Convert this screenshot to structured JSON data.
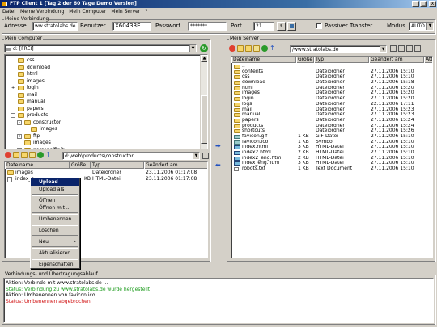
{
  "window": {
    "title": "FTP Client 1 [Tag 2 der 60 Tage Demo Version]",
    "min": "_",
    "max": "□",
    "close": "x"
  },
  "menu": [
    "Datei",
    "Meine Verbindung",
    "Mein Computer",
    "Mein Server",
    "?"
  ],
  "connection": {
    "group_label": "Meine Verbindung",
    "address_label": "Adresse",
    "address": "ww.stratolabs.de",
    "user_label": "Benutzer",
    "user": "X60433E",
    "password_label": "Passwort",
    "password": "*******",
    "port_label": "Port",
    "port": "21",
    "passive_label": "Passiver Transfer",
    "mode_label": "Modus",
    "mode": "AUTO"
  },
  "local": {
    "group_label": "Mein Computer",
    "drive": "d: [FREI]",
    "tree": [
      {
        "label": "css",
        "indent": 2,
        "expander": ""
      },
      {
        "label": "download",
        "indent": 2,
        "expander": ""
      },
      {
        "label": "html",
        "indent": 2,
        "expander": ""
      },
      {
        "label": "images",
        "indent": 2,
        "expander": ""
      },
      {
        "label": "login",
        "indent": 2,
        "expander": "+"
      },
      {
        "label": "mail",
        "indent": 2,
        "expander": ""
      },
      {
        "label": "manual",
        "indent": 2,
        "expander": ""
      },
      {
        "label": "papers",
        "indent": 2,
        "expander": ""
      },
      {
        "label": "products",
        "indent": 2,
        "expander": "-"
      },
      {
        "label": "constructor",
        "indent": 3,
        "expander": "-"
      },
      {
        "label": "images",
        "indent": 4,
        "expander": ""
      },
      {
        "label": "ftp",
        "indent": 3,
        "expander": "+"
      },
      {
        "label": "images",
        "indent": 3,
        "expander": ""
      },
      {
        "label": "personalfinity",
        "indent": 3,
        "expander": "+"
      }
    ],
    "path": "d:\\web\\products\\constructor",
    "columns": [
      "Dateiname",
      "Größe",
      "Typ",
      "Geändert am"
    ],
    "files": [
      {
        "name": "images",
        "size": "",
        "type": "Dateiordner",
        "date": "23.11.2006 01:17:08",
        "kind": "folder"
      },
      {
        "name": "index_c",
        "size": "KB",
        "type": "HTML-Datei",
        "date": "23.11.2006 01:17:08",
        "kind": "file"
      }
    ]
  },
  "context_menu": [
    {
      "label": "Upload",
      "selected": true
    },
    {
      "label": "Upload als"
    },
    {
      "sep": true
    },
    {
      "label": "Öffnen"
    },
    {
      "label": "Öffnen mit ..."
    },
    {
      "sep": true
    },
    {
      "label": "Umbenennen"
    },
    {
      "sep": true
    },
    {
      "label": "Löschen"
    },
    {
      "sep": true
    },
    {
      "label": "Neu",
      "arrow": "►"
    },
    {
      "sep": true
    },
    {
      "label": "Aktualisieren"
    },
    {
      "sep": true
    },
    {
      "label": "Eigenschaften"
    }
  ],
  "remote": {
    "group_label": "Mein Server",
    "path": "/www.stratolabs.de",
    "columns": [
      "Dateiname",
      "Größe",
      "Typ",
      "Geändert am",
      "Attri"
    ],
    "files": [
      {
        "name": "..",
        "size": "",
        "type": "",
        "date": "",
        "kind": "folder"
      },
      {
        "name": "contents",
        "size": "",
        "type": "Dateiordner",
        "date": "27.11.2006 15:10",
        "kind": "folder"
      },
      {
        "name": "css",
        "size": "",
        "type": "Dateiordner",
        "date": "27.11.2006 15:10",
        "kind": "folder"
      },
      {
        "name": "download",
        "size": "",
        "type": "Dateiordner",
        "date": "27.11.2006 15:18",
        "kind": "folder"
      },
      {
        "name": "html",
        "size": "",
        "type": "Dateiordner",
        "date": "27.11.2006 15:20",
        "kind": "folder"
      },
      {
        "name": "images",
        "size": "",
        "type": "Dateiordner",
        "date": "27.11.2006 15:20",
        "kind": "folder"
      },
      {
        "name": "login",
        "size": "",
        "type": "Dateiordner",
        "date": "27.11.2006 15:20",
        "kind": "folder"
      },
      {
        "name": "logs",
        "size": "",
        "type": "Dateiordner",
        "date": "22.11.2006 17:11",
        "kind": "folder"
      },
      {
        "name": "mail",
        "size": "",
        "type": "Dateiordner",
        "date": "27.11.2006 15:23",
        "kind": "folder"
      },
      {
        "name": "manual",
        "size": "",
        "type": "Dateiordner",
        "date": "27.11.2006 15:23",
        "kind": "folder"
      },
      {
        "name": "papers",
        "size": "",
        "type": "Dateiordner",
        "date": "27.11.2006 15:24",
        "kind": "folder"
      },
      {
        "name": "products",
        "size": "",
        "type": "Dateiordner",
        "date": "27.11.2006 15:24",
        "kind": "folder"
      },
      {
        "name": "shortcuts",
        "size": "",
        "type": "Dateiordner",
        "date": "27.11.2006 15:26",
        "kind": "folder"
      },
      {
        "name": "favicon.gif",
        "size": "1 KB",
        "type": "GIF-Datei",
        "date": "27.11.2006 15:10",
        "kind": "gif"
      },
      {
        "name": "favicon.ico",
        "size": "1 KB",
        "type": "Symbol",
        "date": "27.11.2006 15:10",
        "kind": "gif"
      },
      {
        "name": "index.html",
        "size": "3 KB",
        "type": "HTML-Datei",
        "date": "27.11.2006 15:10",
        "kind": "exe"
      },
      {
        "name": "index2.html",
        "size": "2 KB",
        "type": "HTML-Datei",
        "date": "27.11.2006 15:10",
        "kind": "exe"
      },
      {
        "name": "index2_eng.html",
        "size": "2 KB",
        "type": "HTML-Datei",
        "date": "27.11.2006 15:10",
        "kind": "exe"
      },
      {
        "name": "index_eng.html",
        "size": "3 KB",
        "type": "HTML-Datei",
        "date": "27.11.2006 15:10",
        "kind": "exe"
      },
      {
        "name": "robots.txt",
        "size": "1 KB",
        "type": "Text Document",
        "date": "27.11.2006 15:10",
        "kind": "file"
      }
    ]
  },
  "log": {
    "group_label": "Verbindungs- und Übertragungsablauf",
    "lines": [
      {
        "text": "Aktion: Verbinde mit www.stratolabs.de ...",
        "color": "#000000"
      },
      {
        "text": "Status: Verbindung zu www.stratolabs.de wurde hergestellt",
        "color": "#1a9a1a"
      },
      {
        "text": "Aktion: Umbenennen von favicon.ico",
        "color": "#000000"
      },
      {
        "text": "Status: Umbenennen abgebrochen",
        "color": "#d01010"
      }
    ]
  },
  "colors": {
    "title_start": "#0a246a",
    "selection": "#0a246a",
    "face": "#d4d0c8"
  }
}
